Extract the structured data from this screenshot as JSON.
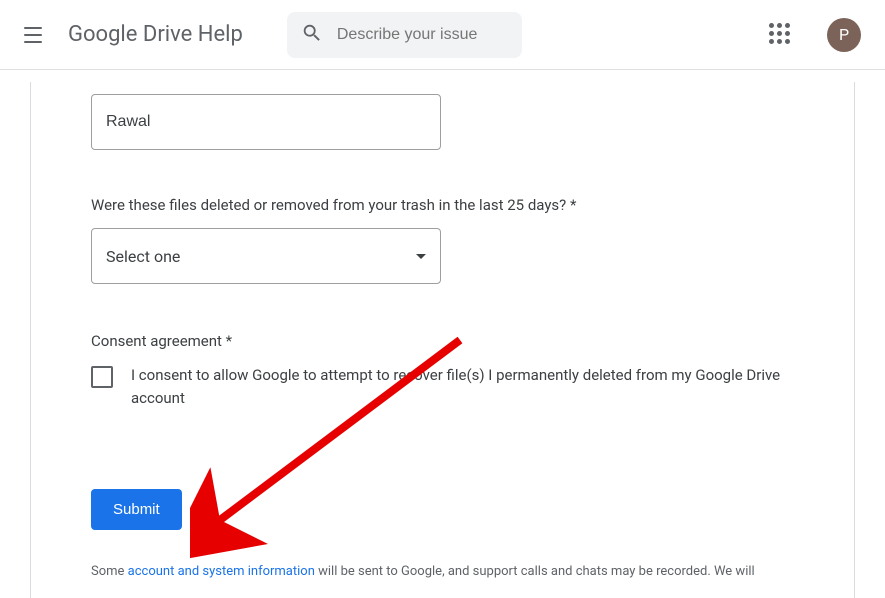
{
  "header": {
    "title": "Google Drive Help",
    "search_placeholder": "Describe your issue",
    "avatar_initial": "P"
  },
  "form": {
    "name_value": "Rawal",
    "deletion_question": "Were these files deleted or removed from your trash in the last 25 days? *",
    "select_placeholder": "Select one",
    "consent_heading": "Consent agreement *",
    "consent_text": "I consent to allow Google to attempt to recover file(s) I permanently deleted from my Google Drive account",
    "submit_label": "Submit"
  },
  "footnote": {
    "prefix": "Some ",
    "link": "account and system information",
    "suffix": " will be sent to Google, and support calls and chats may be recorded. We will"
  },
  "annotation": {
    "arrow_color": "#e60000"
  }
}
